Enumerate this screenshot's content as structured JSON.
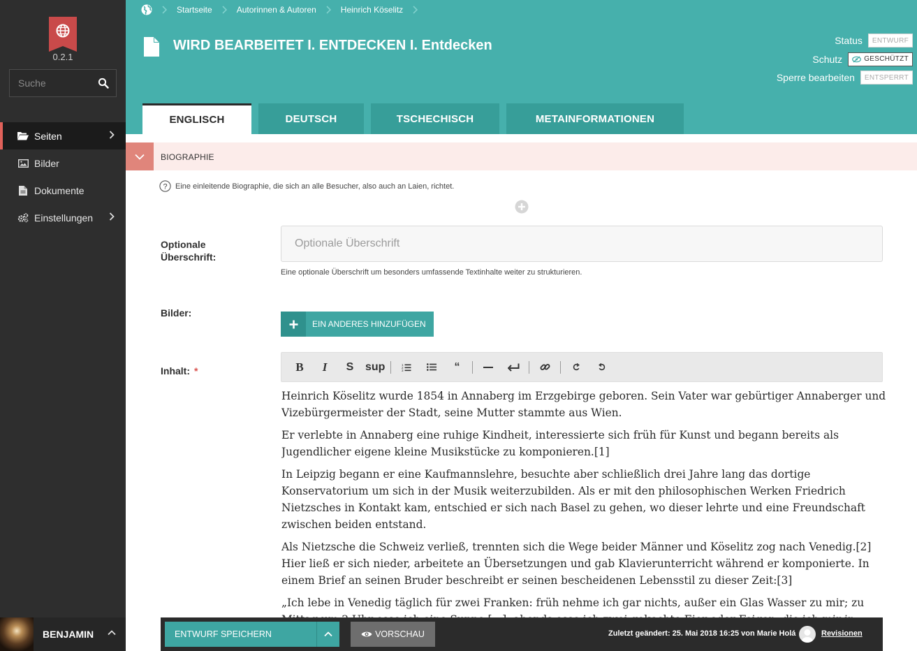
{
  "app": {
    "version": "0.2.1"
  },
  "sidebar": {
    "search_placeholder": "Suche",
    "items": [
      {
        "label": "Seiten",
        "icon": "folder-open-icon",
        "active": true,
        "has_submenu": true
      },
      {
        "label": "Bilder",
        "icon": "image-icon",
        "active": false,
        "has_submenu": false
      },
      {
        "label": "Dokumente",
        "icon": "document-icon",
        "active": false,
        "has_submenu": false
      },
      {
        "label": "Einstellungen",
        "icon": "gears-icon",
        "active": false,
        "has_submenu": true
      }
    ],
    "user": {
      "name": "BENJAMIN"
    }
  },
  "breadcrumb": [
    "Startseite",
    "Autorinnen & Autoren",
    "Heinrich Köselitz"
  ],
  "page": {
    "title_strong": "WIRD BEARBEITET I. ENTDECKEN",
    "title_light": "I. Entdecken"
  },
  "meta": {
    "status_label": "Status",
    "status_value": "ENTWURF",
    "protection_label": "Schutz",
    "protection_value": "GESCHÜTZT",
    "lock_label": "Sperre bearbeiten",
    "lock_value": "ENTSPERRT"
  },
  "tabs": [
    {
      "label": "ENGLISCH",
      "active": true
    },
    {
      "label": "DEUTSCH",
      "active": false
    },
    {
      "label": "TSCHECHISCH",
      "active": false
    },
    {
      "label": "METAINFORMATIONEN",
      "active": false
    }
  ],
  "section": {
    "title": "BIOGRAPHIE",
    "help": "Eine einleitende Biographie, die sich an alle Besucher, also auch an Laien, richtet."
  },
  "form": {
    "heading_label": "Optionale Überschrift:",
    "heading_placeholder": "Optionale Überschrift",
    "heading_hint": "Eine optionale Überschrift um besonders umfassende Textinhalte weiter zu strukturieren.",
    "images_label": "Bilder:",
    "add_button": "EIN ANDERES HINZUFÜGEN",
    "content_label": "Inhalt:",
    "required_mark": "*"
  },
  "editor": {
    "toolbar": {
      "bold": "B",
      "italic": "I",
      "strike": "S",
      "sup": "sup",
      "quote": "“"
    },
    "paragraphs": [
      "Heinrich Köselitz wurde 1854 in Annaberg im Erzgebirge geboren. Sein Vater war gebürtiger Annaberger und Vizebürgermeister der Stadt, seine Mutter stammte aus Wien.",
      "Er verlebte in Annaberg eine ruhige Kindheit, interessierte sich früh für Kunst und begann bereits als Jugendlicher eigene kleine Musikstücke zu komponieren.[1]",
      "In Leipzig begann er eine Kaufmannslehre, besuchte aber schließlich drei Jahre lang das dortige Konservatorium um sich in der Musik weiterzubilden. Als er mit den philosophischen Werken Friedrich Nietzsches in Kontakt kam, entschied er sich nach Basel zu gehen, wo dieser lehrte und eine Freundschaft zwischen beiden entstand.",
      "Als Nietzsche die Schweiz verließ, trennten sich die Wege beider Männer und Köselitz zog nach Venedig.[2] Hier ließ er sich nieder, arbeitete an Übersetzungen und gab Klavierunterricht während er komponierte. In einem Brief an seinen Bruder beschreibt er seinen bescheidenen Lebensstil zu dieser Zeit:[3]",
      "„Ich lebe in Venedig täglich für zwei Franken: früh nehme ich gar nichts, außer ein Glas Wasser zu mir; zu Mittag um 2 Uhr esse ich eine Suppe [...]; abends esse ich zwei gekochte Eier oder Feigen, die ich mir in Läden hole, und trinke eine Tasse Kaffee.“"
    ]
  },
  "footer": {
    "save_label": "ENTWURF SPEICHERN",
    "preview_label": "VORSCHAU",
    "last_changed": "Zuletzt geändert: 25. Mai 2018 16:25 von Marie Holá",
    "revisions_label": "Revisionen"
  },
  "colors": {
    "accent": "#46b0ac",
    "sidebar": "#2e2e2e",
    "section_bg": "#fcecea",
    "section_toggle": "#e0857b",
    "logo": "#c94a4a"
  }
}
